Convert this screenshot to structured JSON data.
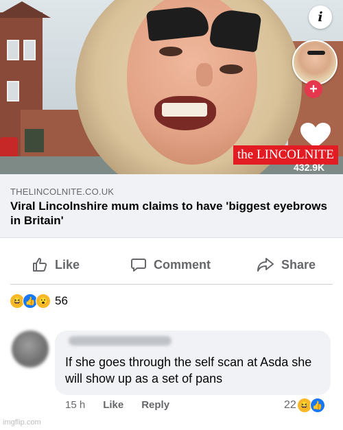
{
  "post": {
    "image": {
      "badge": "the LINCOLNITE",
      "views": "432.9K",
      "info_icon_label": "i",
      "plus_label": "+"
    },
    "link": {
      "domain": "THELINCOLNITE.CO.UK",
      "headline": "Viral Lincolnshire mum claims to have 'biggest eyebrows in Britain'"
    },
    "actions": {
      "like": "Like",
      "comment": "Comment",
      "share": "Share"
    },
    "reactions": {
      "icons": [
        "haha-icon",
        "like-icon",
        "wow-icon"
      ],
      "count": "56"
    }
  },
  "comment": {
    "text": "If she goes through the self scan at Asda she will show up as a set of pans",
    "time": "15 h",
    "like": "Like",
    "reply": "Reply",
    "reaction_count": "22",
    "reaction_icons": [
      "haha-icon",
      "like-icon"
    ]
  },
  "watermark": "imgflip.com",
  "colors": {
    "brand_red": "#e31b23",
    "fb_blue": "#1877f2",
    "text_gray": "#65676b",
    "bubble": "#f0f2f5"
  }
}
